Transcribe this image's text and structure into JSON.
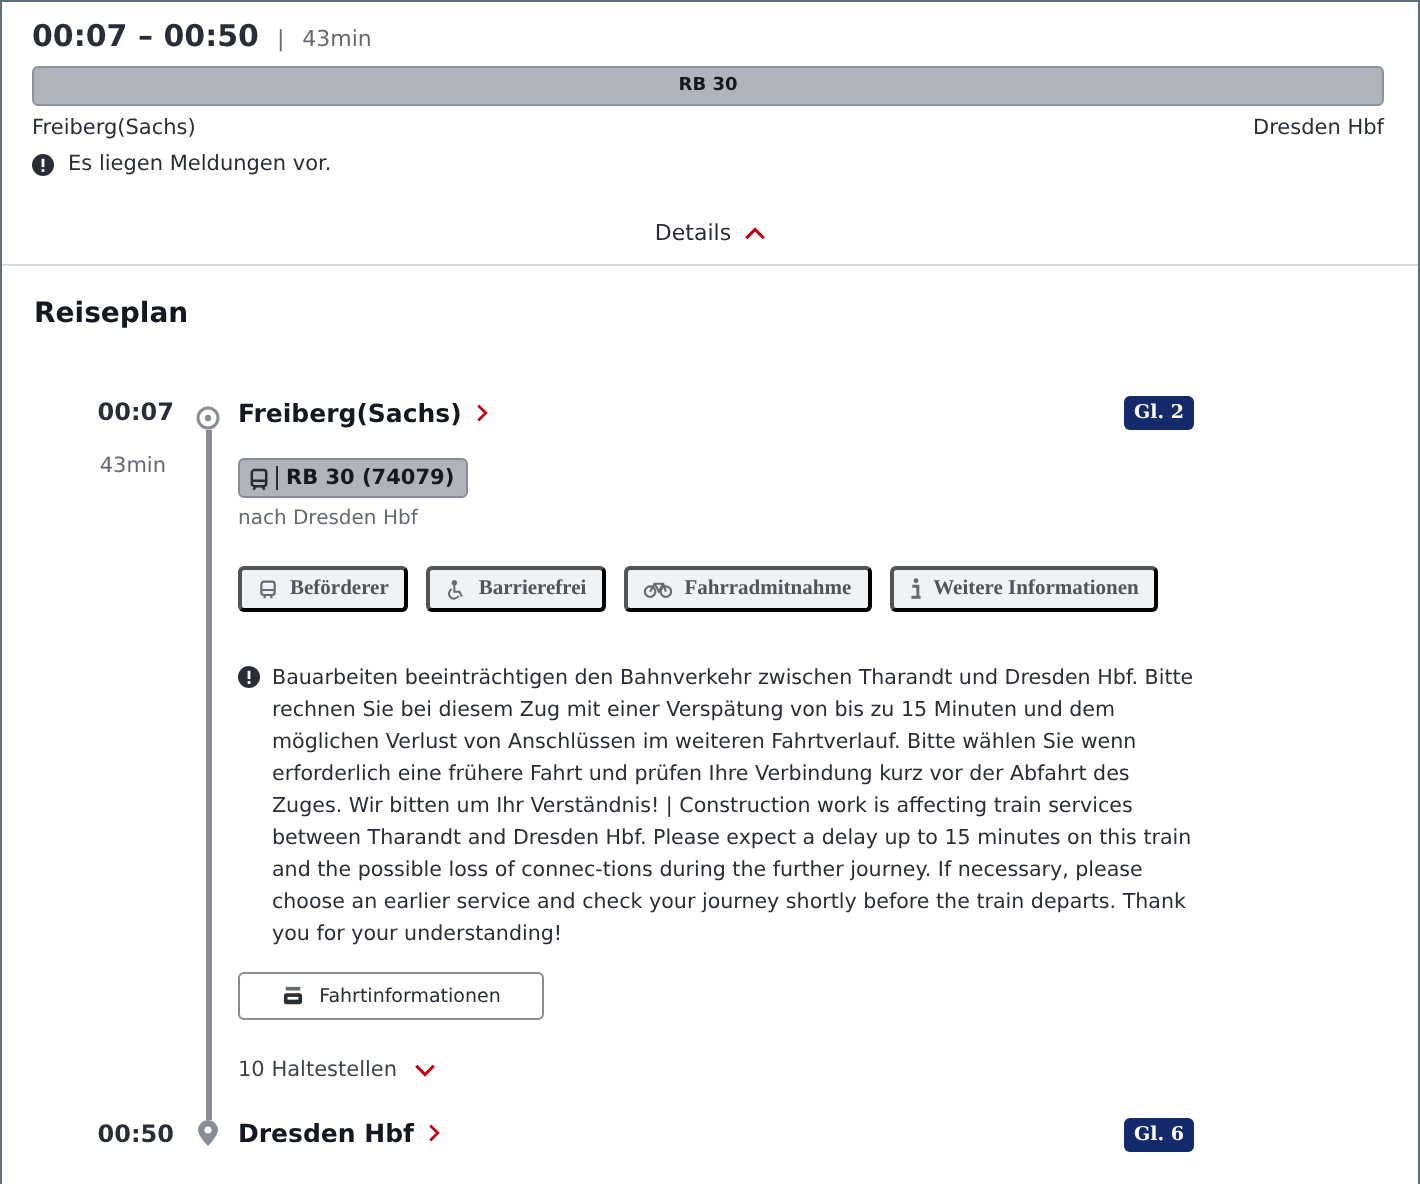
{
  "summary": {
    "times": "00:07 – 00:50",
    "separator": "|",
    "duration": "43min",
    "train": "RB 30",
    "from": "Freiberg(Sachs)",
    "to": "Dresden Hbf",
    "notice": "Es liegen Meldungen vor.",
    "details": "Details",
    "expanded": true
  },
  "plan": {
    "title": "Reiseplan",
    "start": {
      "time": "00:07",
      "station": "Freiberg(Sachs)",
      "platform": "Gl. 2"
    },
    "leg": {
      "duration": "43min",
      "train": "RB 30 (74079)",
      "direction": "nach Dresden Hbf",
      "features": [
        {
          "kind": "operator",
          "label": "Beförderer"
        },
        {
          "kind": "accessible",
          "label": "Barrierefrei"
        },
        {
          "kind": "bike",
          "label": "Fahrradmitnahme"
        },
        {
          "kind": "info",
          "label": "Weitere Informationen"
        }
      ],
      "message": "Bauarbeiten beeinträchtigen den Bahnverkehr zwischen Tharandt und Dresden Hbf. Bitte rechnen Sie bei diesem Zug mit einer Verspätung von bis zu 15 Minuten und dem möglichen Verlust von Anschlüssen im weiteren Fahrtverlauf. Bitte wählen Sie wenn erforderlich eine frühere Fahrt und prüfen Ihre Verbindung kurz vor der Abfahrt des Zuges. Wir bitten um Ihr Verständnis! | Construction work is affecting train services between Tharandt and Dresden Hbf. Please expect a delay up to 15 minutes on this train and the possible loss of connec-tions during the further journey. If necessary, please choose an earlier service and check your journey shortly before the train departs. Thank you for your understanding!",
      "info_button": "Fahrtinformationen",
      "stops_toggle": "10 Haltestellen",
      "stops_expanded": false
    },
    "end": {
      "time": "00:50",
      "station": "Dresden Hbf",
      "platform": "Gl. 6"
    }
  }
}
